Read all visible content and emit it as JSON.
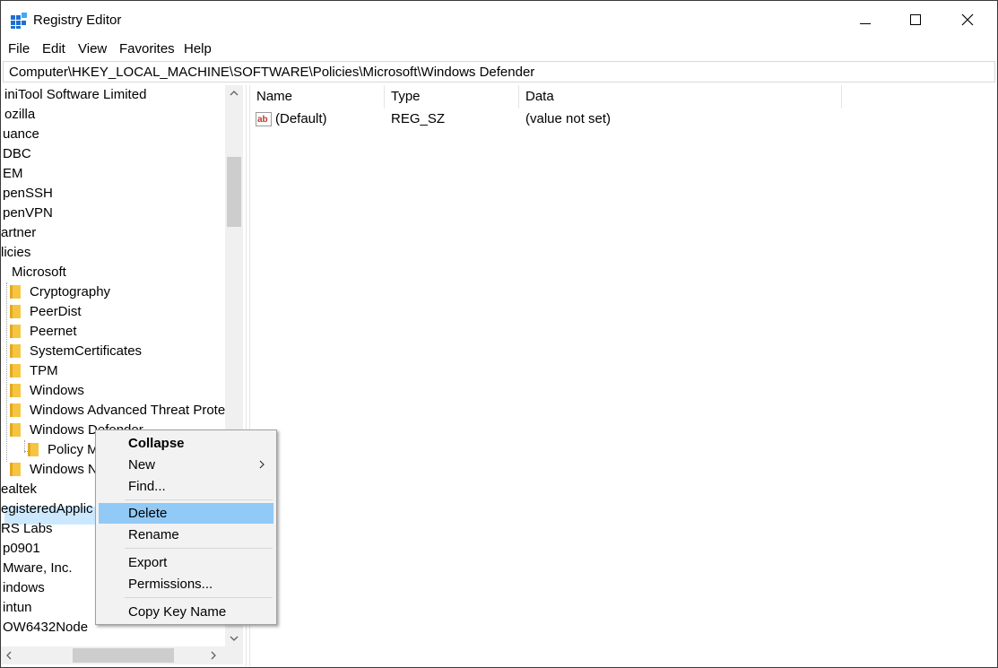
{
  "window": {
    "title": "Registry Editor"
  },
  "menubar": {
    "items": [
      "File",
      "Edit",
      "View",
      "Favorites",
      "Help"
    ]
  },
  "address": {
    "path": "Computer\\HKEY_LOCAL_MACHINE\\SOFTWARE\\Policies\\Microsoft\\Windows Defender"
  },
  "tree": {
    "top_items": [
      "iniTool Software Limited",
      "ozilla",
      "uance",
      "DBC",
      "EM",
      "penSSH",
      "penVPN",
      "artner",
      "licies"
    ],
    "microsoft": "Microsoft",
    "microsoft_children": [
      "Cryptography",
      "PeerDist",
      "Peernet",
      "SystemCertificates",
      "TPM",
      "Windows",
      "Windows Advanced Threat Prote",
      "Windows Defender"
    ],
    "policy_child": "Policy M",
    "windows_n": "Windows N",
    "bottom_items": [
      "ealtek",
      "egisteredApplic",
      "RS Labs",
      "p0901",
      "Mware, Inc.",
      "indows",
      "intun",
      "OW6432Node"
    ]
  },
  "list": {
    "headers": {
      "name": "Name",
      "type": "Type",
      "data": "Data"
    },
    "rows": [
      {
        "name": "(Default)",
        "type": "REG_SZ",
        "data": "(value not set)",
        "icon": "string-value-icon"
      }
    ]
  },
  "context_menu": {
    "items": {
      "collapse": "Collapse",
      "new": "New",
      "find": "Find...",
      "delete": "Delete",
      "rename": "Rename",
      "export": "Export",
      "permissions": "Permissions...",
      "copy_key_name": "Copy Key Name"
    },
    "hovered": "Delete"
  },
  "colors": {
    "selection": "#cce8ff",
    "menu_hover": "#91c9f7",
    "folder": "#f5c542"
  }
}
